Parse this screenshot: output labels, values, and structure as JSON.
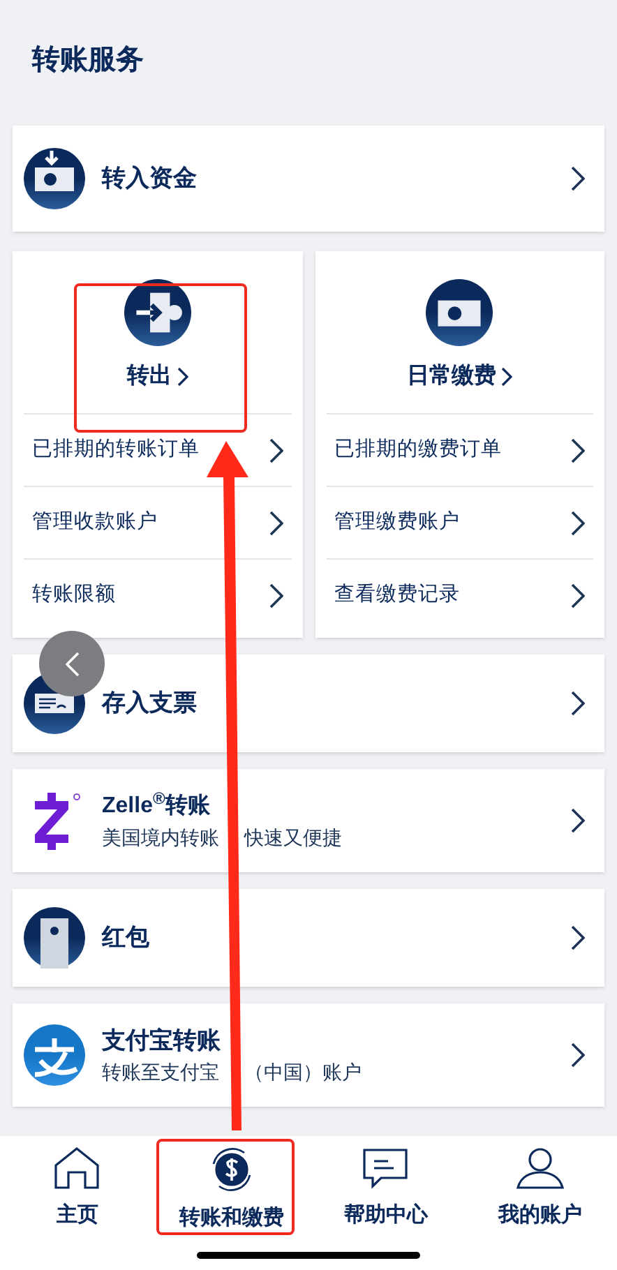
{
  "header": {
    "title": "转账服务"
  },
  "transfer_in": {
    "label": "转入资金"
  },
  "panels": [
    {
      "kind": "transfer",
      "title": "转出",
      "links": [
        {
          "label": "已排期的转账订单"
        },
        {
          "label": "管理收款账户"
        },
        {
          "label": "转账限额"
        }
      ]
    },
    {
      "kind": "bill",
      "title": "日常缴费",
      "links": [
        {
          "label": "已排期的缴费订单"
        },
        {
          "label": "管理缴费账户"
        },
        {
          "label": "查看缴费记录"
        }
      ]
    }
  ],
  "services": [
    {
      "kind": "cheque",
      "title": "存入支票"
    },
    {
      "kind": "zelle",
      "title": "Zelle$^{®}$转账",
      "subtitle_parts": [
        "美国境内转账",
        "快速又便捷"
      ]
    },
    {
      "kind": "envelope",
      "title": "红包"
    },
    {
      "kind": "alipay",
      "title": "支付宝转账",
      "subtitle_parts": [
        "转账至支付宝",
        "（中国）账户"
      ]
    }
  ],
  "tab_bar": [
    {
      "kind": "home",
      "label": "主页",
      "selected": false
    },
    {
      "kind": "transfer",
      "label": "转账和缴费",
      "selected": true
    },
    {
      "kind": "help",
      "label": "帮助中心",
      "selected": false
    },
    {
      "kind": "account",
      "label": "我的账户",
      "selected": false
    }
  ]
}
